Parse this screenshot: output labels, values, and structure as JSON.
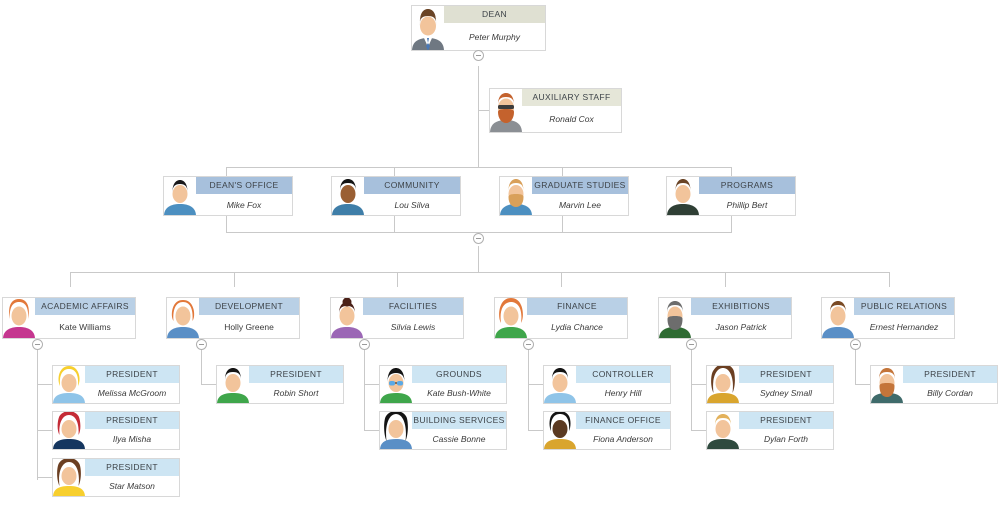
{
  "chart": {
    "type": "orgchart",
    "title": "Organizational Chart",
    "colors": {
      "dean_header": "#dfe0d2",
      "auxiliary_header": "#e5e6d8",
      "division_header": "#a7c0dc",
      "director_header": "#b9d0e6",
      "leaf_header": "#cde5f3",
      "card_border": "#d8d8d8",
      "connector": "#c9c9c9",
      "card_background": "#ffffff"
    }
  },
  "nodes": {
    "dean": {
      "title": "DEAN",
      "name": "Peter Murphy"
    },
    "auxiliary": {
      "title": "AUXILIARY STAFF",
      "name": "Ronald Cox"
    },
    "deans_office": {
      "title": "DEAN'S OFFICE",
      "name": "Mike Fox"
    },
    "community": {
      "title": "COMMUNITY",
      "name": "Lou Silva"
    },
    "graduate_studies": {
      "title": "GRADUATE STUDIES",
      "name": "Marvin Lee"
    },
    "programs": {
      "title": "PROGRAMS",
      "name": "Phillip Bert"
    },
    "academic_affairs": {
      "title": "ACADEMIC AFFAIRS",
      "name": "Kate Williams"
    },
    "development": {
      "title": "DEVELOPMENT",
      "name": "Holly Greene"
    },
    "facilities": {
      "title": "FACILITIES",
      "name": "Silvia Lewis"
    },
    "finance": {
      "title": "FINANCE",
      "name": "Lydia Chance"
    },
    "exhibitions": {
      "title": "EXHIBITIONS",
      "name": "Jason Patrick"
    },
    "public_relations": {
      "title": "PUBLIC RELATIONS",
      "name": "Ernest Hernandez"
    },
    "melissa": {
      "title": "PRESIDENT",
      "name": "Melissa McGroom"
    },
    "ilya": {
      "title": "PRESIDENT",
      "name": "Ilya Misha"
    },
    "star": {
      "title": "PRESIDENT",
      "name": "Star Matson"
    },
    "robin": {
      "title": "PRESIDENT",
      "name": "Robin Short"
    },
    "grounds": {
      "title": "GROUNDS",
      "name": "Kate Bush-White"
    },
    "building": {
      "title": "BUILDING SERVICES",
      "name": "Cassie Bonne"
    },
    "controller": {
      "title": "CONTROLLER",
      "name": "Henry Hill"
    },
    "finance_office": {
      "title": "FINANCE OFFICE",
      "name": "Fiona Anderson"
    },
    "sydney": {
      "title": "PRESIDENT",
      "name": "Sydney Small"
    },
    "dylan": {
      "title": "PRESIDENT",
      "name": "Dylan Forth"
    },
    "billy": {
      "title": "PRESIDENT",
      "name": "Billy Cordan"
    }
  },
  "toggles": {
    "dean": {
      "label": "collapse",
      "state": "expanded"
    },
    "programs_row": {
      "label": "collapse",
      "state": "expanded"
    },
    "academic_affairs": {
      "label": "collapse",
      "state": "expanded"
    },
    "development": {
      "label": "collapse",
      "state": "expanded"
    },
    "facilities": {
      "label": "collapse",
      "state": "expanded"
    },
    "finance": {
      "label": "collapse",
      "state": "expanded"
    },
    "exhibitions": {
      "label": "collapse",
      "state": "expanded"
    },
    "public_relations": {
      "label": "collapse",
      "state": "expanded"
    }
  }
}
